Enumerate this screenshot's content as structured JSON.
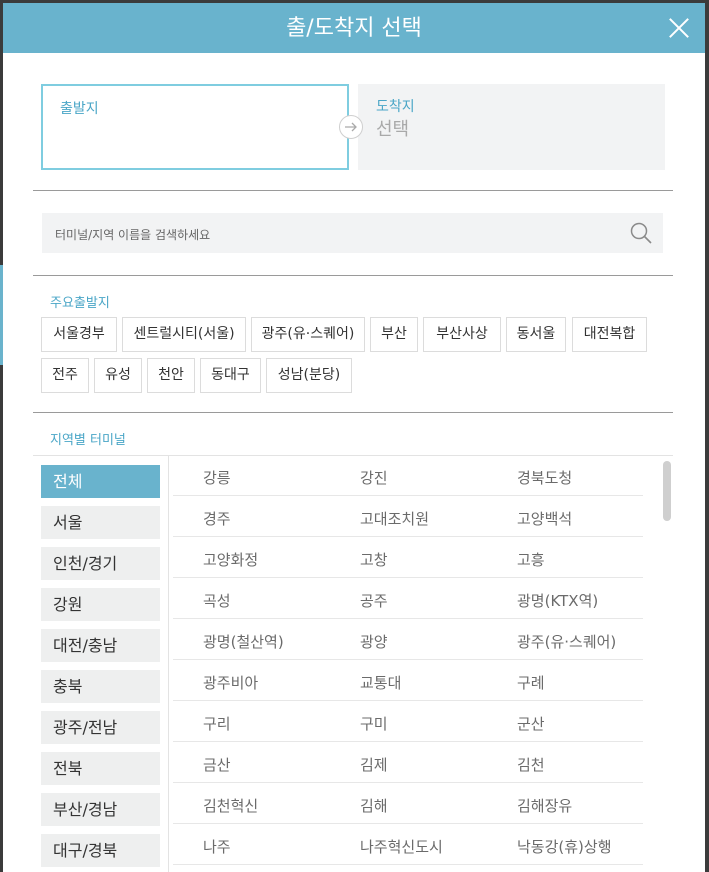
{
  "header": {
    "title": "출/도착지 선택"
  },
  "route": {
    "departure_label": "출발지",
    "arrival_label": "도착지",
    "arrival_value": "선택"
  },
  "search": {
    "placeholder": "터미널/지역 이름을 검색하세요"
  },
  "major": {
    "title": "주요출발지",
    "row1": [
      "서울경부",
      "센트럴시티(서울)",
      "광주(유·스퀘어)",
      "부산",
      "부산사상",
      "동서울",
      "대전복합"
    ],
    "row2": [
      "전주",
      "유성",
      "천안",
      "동대구",
      "성남(분당)"
    ]
  },
  "regions": {
    "title": "지역별 터미널",
    "tabs": [
      "전체",
      "서울",
      "인천/경기",
      "강원",
      "대전/충남",
      "충북",
      "광주/전남",
      "전북",
      "부산/경남",
      "대구/경북"
    ],
    "active": "전체"
  },
  "terminals": [
    [
      "강릉",
      "강진",
      "경북도청"
    ],
    [
      "경주",
      "고대조치원",
      "고양백석"
    ],
    [
      "고양화정",
      "고창",
      "고흥"
    ],
    [
      "곡성",
      "공주",
      "광명(KTX역)"
    ],
    [
      "광명(철산역)",
      "광양",
      "광주(유·스퀘어)"
    ],
    [
      "광주비아",
      "교통대",
      "구례"
    ],
    [
      "구리",
      "구미",
      "군산"
    ],
    [
      "금산",
      "김제",
      "김천"
    ],
    [
      "김천혁신",
      "김해",
      "김해장유"
    ],
    [
      "나주",
      "나주혁신도시",
      "낙동강(휴)상행"
    ]
  ],
  "colors": {
    "accent": "#69b3cd",
    "label": "#4aa6c7"
  }
}
